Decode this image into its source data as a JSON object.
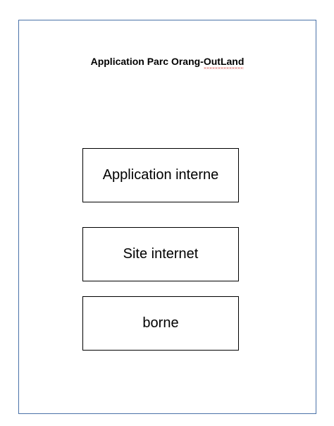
{
  "title": {
    "prefix": "Application Parc Orang-",
    "misspelled": "OutLand"
  },
  "boxes": [
    {
      "label": "Application interne"
    },
    {
      "label": "Site internet"
    },
    {
      "label": "borne"
    }
  ],
  "colors": {
    "frame_border": "#4a72a8",
    "box_border": "#000000",
    "spellcheck_underline": "#d0312d"
  }
}
